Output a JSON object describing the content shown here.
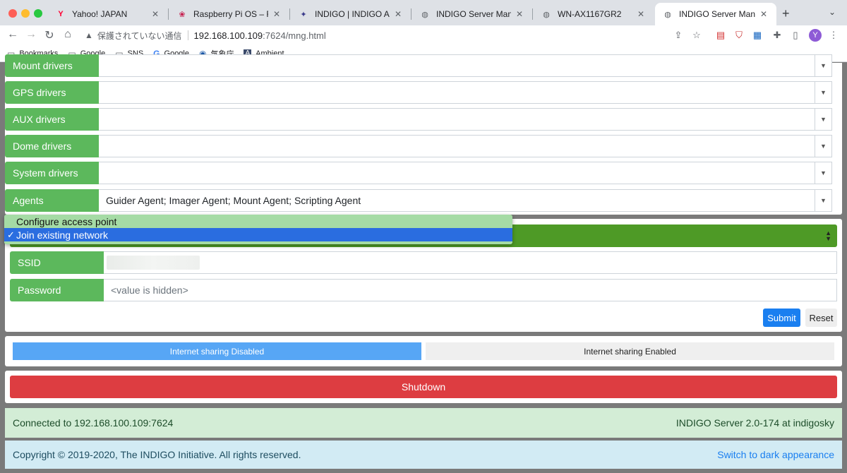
{
  "browser": {
    "tabs": [
      {
        "title": "Yahoo! JAPAN",
        "icon": "Y"
      },
      {
        "title": "Raspberry Pi OS – Raspb",
        "icon": "❀"
      },
      {
        "title": "INDIGO | INDIGO Astrono",
        "icon": "✦"
      },
      {
        "title": "INDIGO Server Manager",
        "icon": "◍"
      },
      {
        "title": "WN-AX1167GR2",
        "icon": "◍"
      },
      {
        "title": "INDIGO Server Manager",
        "icon": "◍"
      }
    ],
    "security_text": "保護されていない通信",
    "url_host": "192.168.100.109",
    "url_path": ":7624/mng.html",
    "avatar_letter": "Y",
    "bookmarks": [
      {
        "label": "Bookmarks",
        "icon": "folder-icon"
      },
      {
        "label": "Google",
        "icon": "folder-icon"
      },
      {
        "label": "SNS",
        "icon": "folder-icon"
      },
      {
        "label": "Google",
        "icon": "google-icon"
      },
      {
        "label": "気象庁",
        "icon": "jma-icon"
      },
      {
        "label": "Ambient",
        "icon": "ambient-icon"
      }
    ]
  },
  "drivers": [
    {
      "label": "Mount drivers",
      "value": ""
    },
    {
      "label": "GPS drivers",
      "value": ""
    },
    {
      "label": "AUX drivers",
      "value": ""
    },
    {
      "label": "Dome drivers",
      "value": ""
    },
    {
      "label": "System drivers",
      "value": ""
    },
    {
      "label": "Agents",
      "value": "Guider Agent; Imager Agent; Mount Agent; Scripting Agent"
    }
  ],
  "network": {
    "options": [
      "Configure access point",
      "Join existing network"
    ],
    "selected": "Join existing network",
    "ssid_label": "SSID",
    "password_label": "Password",
    "password_placeholder": "<value is hidden>",
    "submit": "Submit",
    "reset": "Reset"
  },
  "sharing": {
    "disabled": "Internet sharing Disabled",
    "enabled": "Internet sharing Enabled"
  },
  "shutdown": "Shutdown",
  "status": {
    "connected": "Connected to 192.168.100.109:7624",
    "server": "INDIGO Server 2.0-174 at indigosky"
  },
  "footer": {
    "copyright": "Copyright © 2019-2020, The INDIGO Initiative. All rights reserved.",
    "dark_link": "Switch to dark appearance"
  },
  "colors": {
    "label_green": "#5cb85c",
    "selected_blue": "#2a6de0",
    "submit_blue": "#1a7ff0",
    "shutdown_red": "#dd3d41"
  }
}
